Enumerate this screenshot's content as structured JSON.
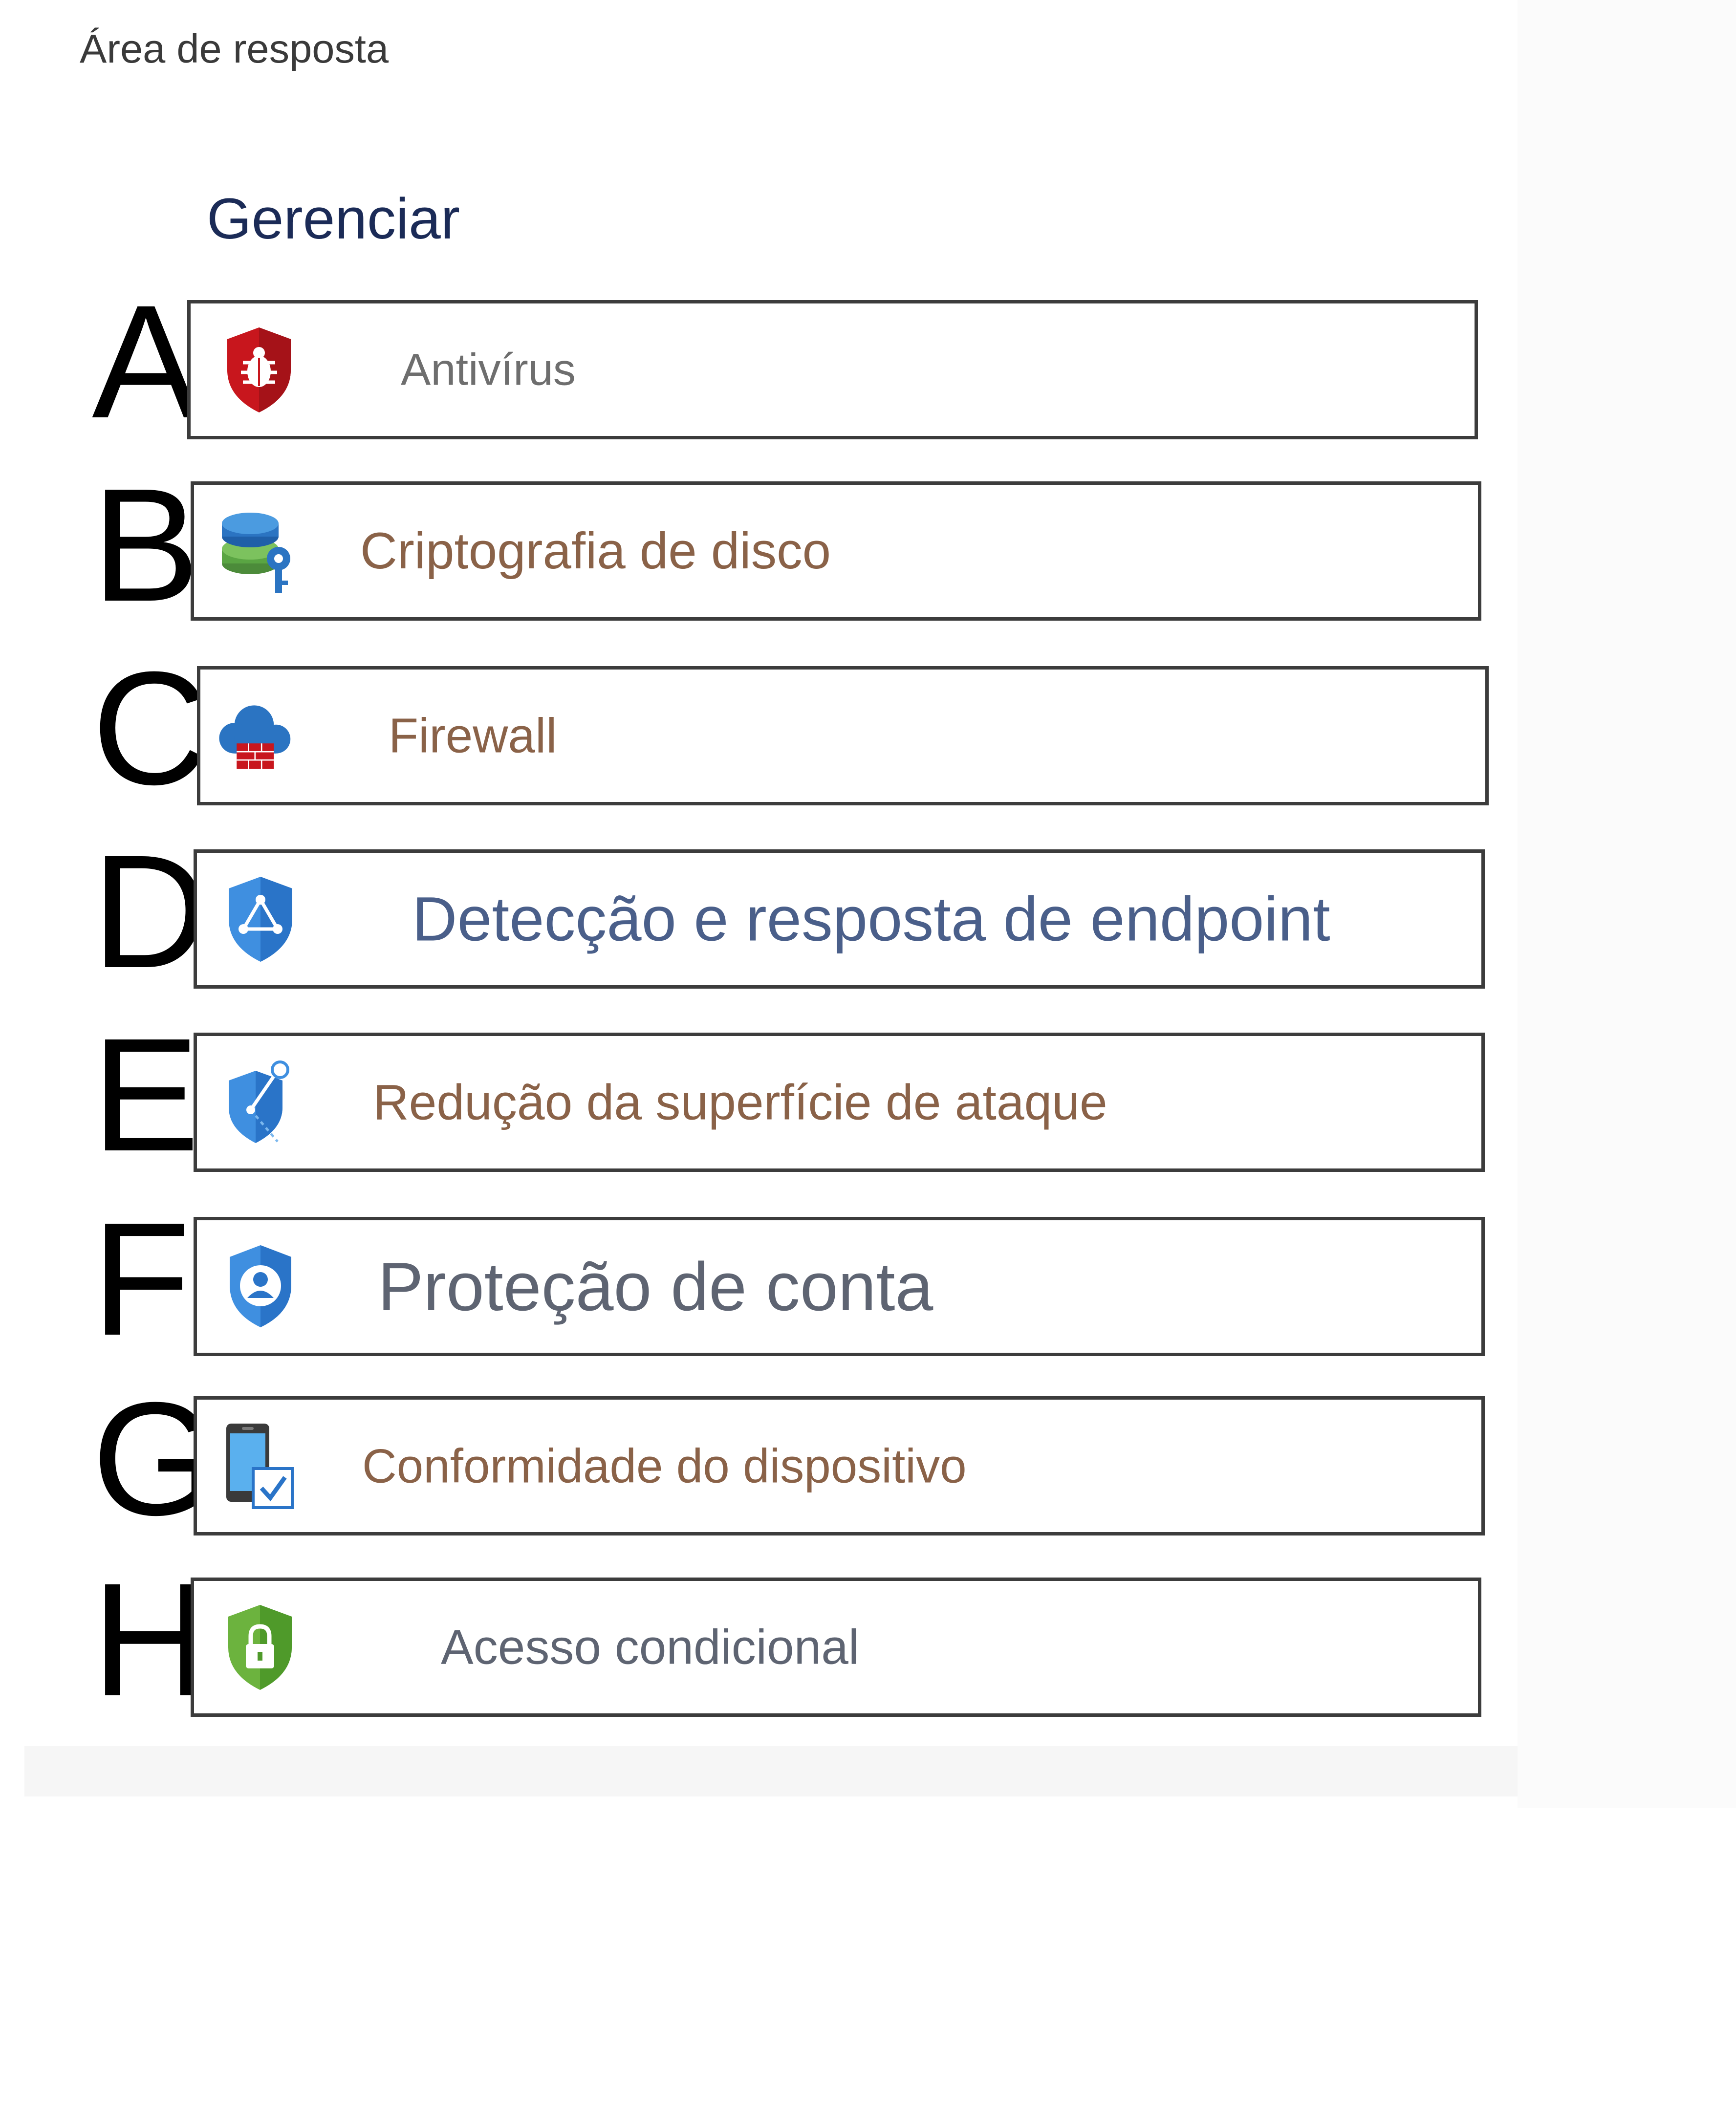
{
  "header": {
    "area_title": "Área de resposta",
    "section_title": "Gerenciar"
  },
  "items": [
    {
      "letter": "A",
      "label": "Antivírus",
      "icon": "shield-bug-icon",
      "color": "#6e6e6e"
    },
    {
      "letter": "B",
      "label": "Criptografia de disco",
      "icon": "disk-key-icon",
      "color": "#8a6248"
    },
    {
      "letter": "C",
      "label": "Firewall",
      "icon": "cloud-firewall-icon",
      "color": "#8a6248"
    },
    {
      "letter": "D",
      "label": "Detecção e resposta de endpoint",
      "icon": "shield-network-icon",
      "color": "#4a5f8a"
    },
    {
      "letter": "E",
      "label": "Redução da superfície de ataque",
      "icon": "shield-node-icon",
      "color": "#8a6248"
    },
    {
      "letter": "F",
      "label": "Proteção de conta",
      "icon": "shield-user-icon",
      "color": "#5e6472"
    },
    {
      "letter": "G",
      "label": "Conformidade do dispositivo",
      "icon": "phone-check-icon",
      "color": "#8a6248"
    },
    {
      "letter": "H",
      "label": "Acesso condicional",
      "icon": "shield-lock-icon",
      "color": "#5e6472"
    }
  ]
}
